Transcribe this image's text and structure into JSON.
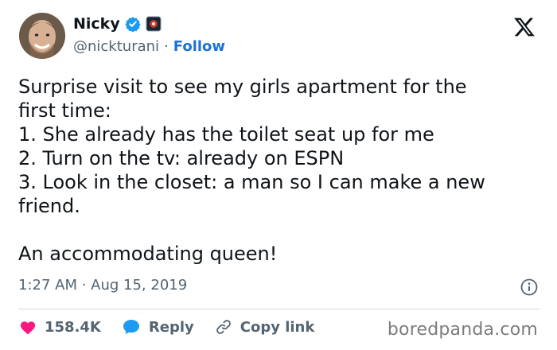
{
  "author": {
    "display_name": "Nicky",
    "handle": "@nickturani",
    "separator": "·",
    "follow_label": "Follow"
  },
  "tweet": {
    "text": "Surprise visit to see my girls apartment for the\nfirst time:\n1. She already has the toilet seat up for me\n2. Turn on the tv: already on ESPN\n3. Look in the closet: a man so I can make a new\nfriend.\n\nAn accommodating queen!",
    "timestamp": "1:27 AM · Aug 15, 2019"
  },
  "actions": {
    "likes_count": "158.4K",
    "reply_label": "Reply",
    "copy_link_label": "Copy link"
  },
  "watermark": "boredpanda.com",
  "colors": {
    "like": "#f91880",
    "reply": "#1d9bf0",
    "follow": "#1d72d4",
    "verified": "#1d9bf0",
    "muted": "#536471"
  },
  "icons": [
    "verified-badge-icon",
    "x-logo-icon",
    "info-icon",
    "heart-icon",
    "reply-bubble-icon",
    "link-icon"
  ]
}
